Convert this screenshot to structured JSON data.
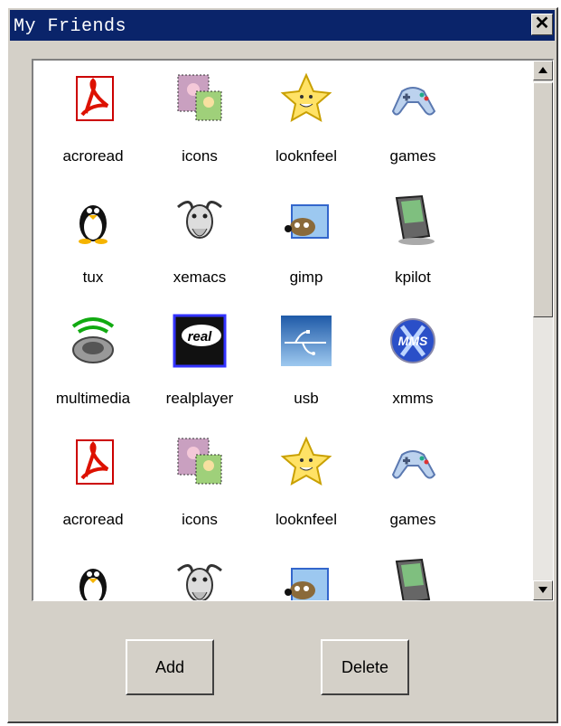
{
  "window": {
    "title": "My Friends"
  },
  "list": {
    "items": [
      {
        "label": "acroread",
        "icon": "acroread-icon"
      },
      {
        "label": "icons",
        "icon": "stamps-icon"
      },
      {
        "label": "looknfeel",
        "icon": "star-icon"
      },
      {
        "label": "games",
        "icon": "gamepad-icon"
      },
      {
        "label": "tux",
        "icon": "penguin-icon"
      },
      {
        "label": "xemacs",
        "icon": "gnu-icon"
      },
      {
        "label": "gimp",
        "icon": "gimp-icon"
      },
      {
        "label": "kpilot",
        "icon": "pda-icon"
      },
      {
        "label": "multimedia",
        "icon": "speaker-icon"
      },
      {
        "label": "realplayer",
        "icon": "real-icon"
      },
      {
        "label": "usb",
        "icon": "usb-icon"
      },
      {
        "label": "xmms",
        "icon": "xmms-icon"
      },
      {
        "label": "acroread",
        "icon": "acroread-icon"
      },
      {
        "label": "icons",
        "icon": "stamps-icon"
      },
      {
        "label": "looknfeel",
        "icon": "star-icon"
      },
      {
        "label": "games",
        "icon": "gamepad-icon"
      },
      {
        "label": "",
        "icon": "penguin-icon"
      },
      {
        "label": "",
        "icon": "gnu-icon"
      },
      {
        "label": "",
        "icon": "gimp-icon"
      },
      {
        "label": "",
        "icon": "pda-icon"
      }
    ],
    "real_logo_text": "real",
    "xmms_logo_text": "MMS"
  },
  "buttons": {
    "add": "Add",
    "delete": "Delete"
  },
  "colors": {
    "titlebar": "#0a246a",
    "face": "#d4d0c8"
  }
}
